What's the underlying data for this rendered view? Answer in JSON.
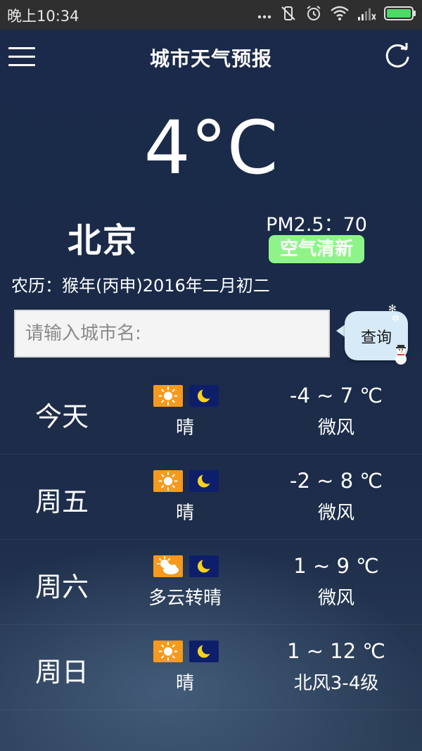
{
  "status_bar": {
    "time": "晚上10:34",
    "icons": [
      "more-dots-icon",
      "vibrate-off-icon",
      "alarm-icon",
      "wifi-icon",
      "signal-icon",
      "battery-icon"
    ]
  },
  "header": {
    "title": "城市天气预报",
    "menu_icon": "menu-icon",
    "refresh_icon": "refresh-icon"
  },
  "current": {
    "temperature": "4°C",
    "city": "北京",
    "pm25": "PM2.5：70",
    "air_quality": "空气清新",
    "lunar_date": "农历：猴年(丙申)2016年二月初二"
  },
  "search": {
    "placeholder": "请输入城市名:",
    "value": "",
    "button_label": "查询"
  },
  "forecast": [
    {
      "day": "今天",
      "day_icon": "sunny-icon",
      "night_icon": "moon-icon",
      "condition": "晴",
      "temp_range": "-4 ~ 7 ℃",
      "wind": "微风"
    },
    {
      "day": "周五",
      "day_icon": "sunny-icon",
      "night_icon": "moon-icon",
      "condition": "晴",
      "temp_range": "-2 ~ 8 ℃",
      "wind": "微风"
    },
    {
      "day": "周六",
      "day_icon": "partly-cloudy-icon",
      "night_icon": "moon-icon",
      "condition": "多云转晴",
      "temp_range": "1 ~ 9 ℃",
      "wind": "微风"
    },
    {
      "day": "周日",
      "day_icon": "sunny-icon",
      "night_icon": "moon-icon",
      "condition": "晴",
      "temp_range": "1 ~ 12 ℃",
      "wind": "北风3-4级"
    }
  ],
  "colors": {
    "background": "#1b2a4a",
    "status_bar": "#2f2f2f",
    "air_badge": "#8ef48a",
    "sun_tile": "#f59a1c",
    "moon_tile": "#0d1f6b",
    "battery": "#4cd964"
  }
}
